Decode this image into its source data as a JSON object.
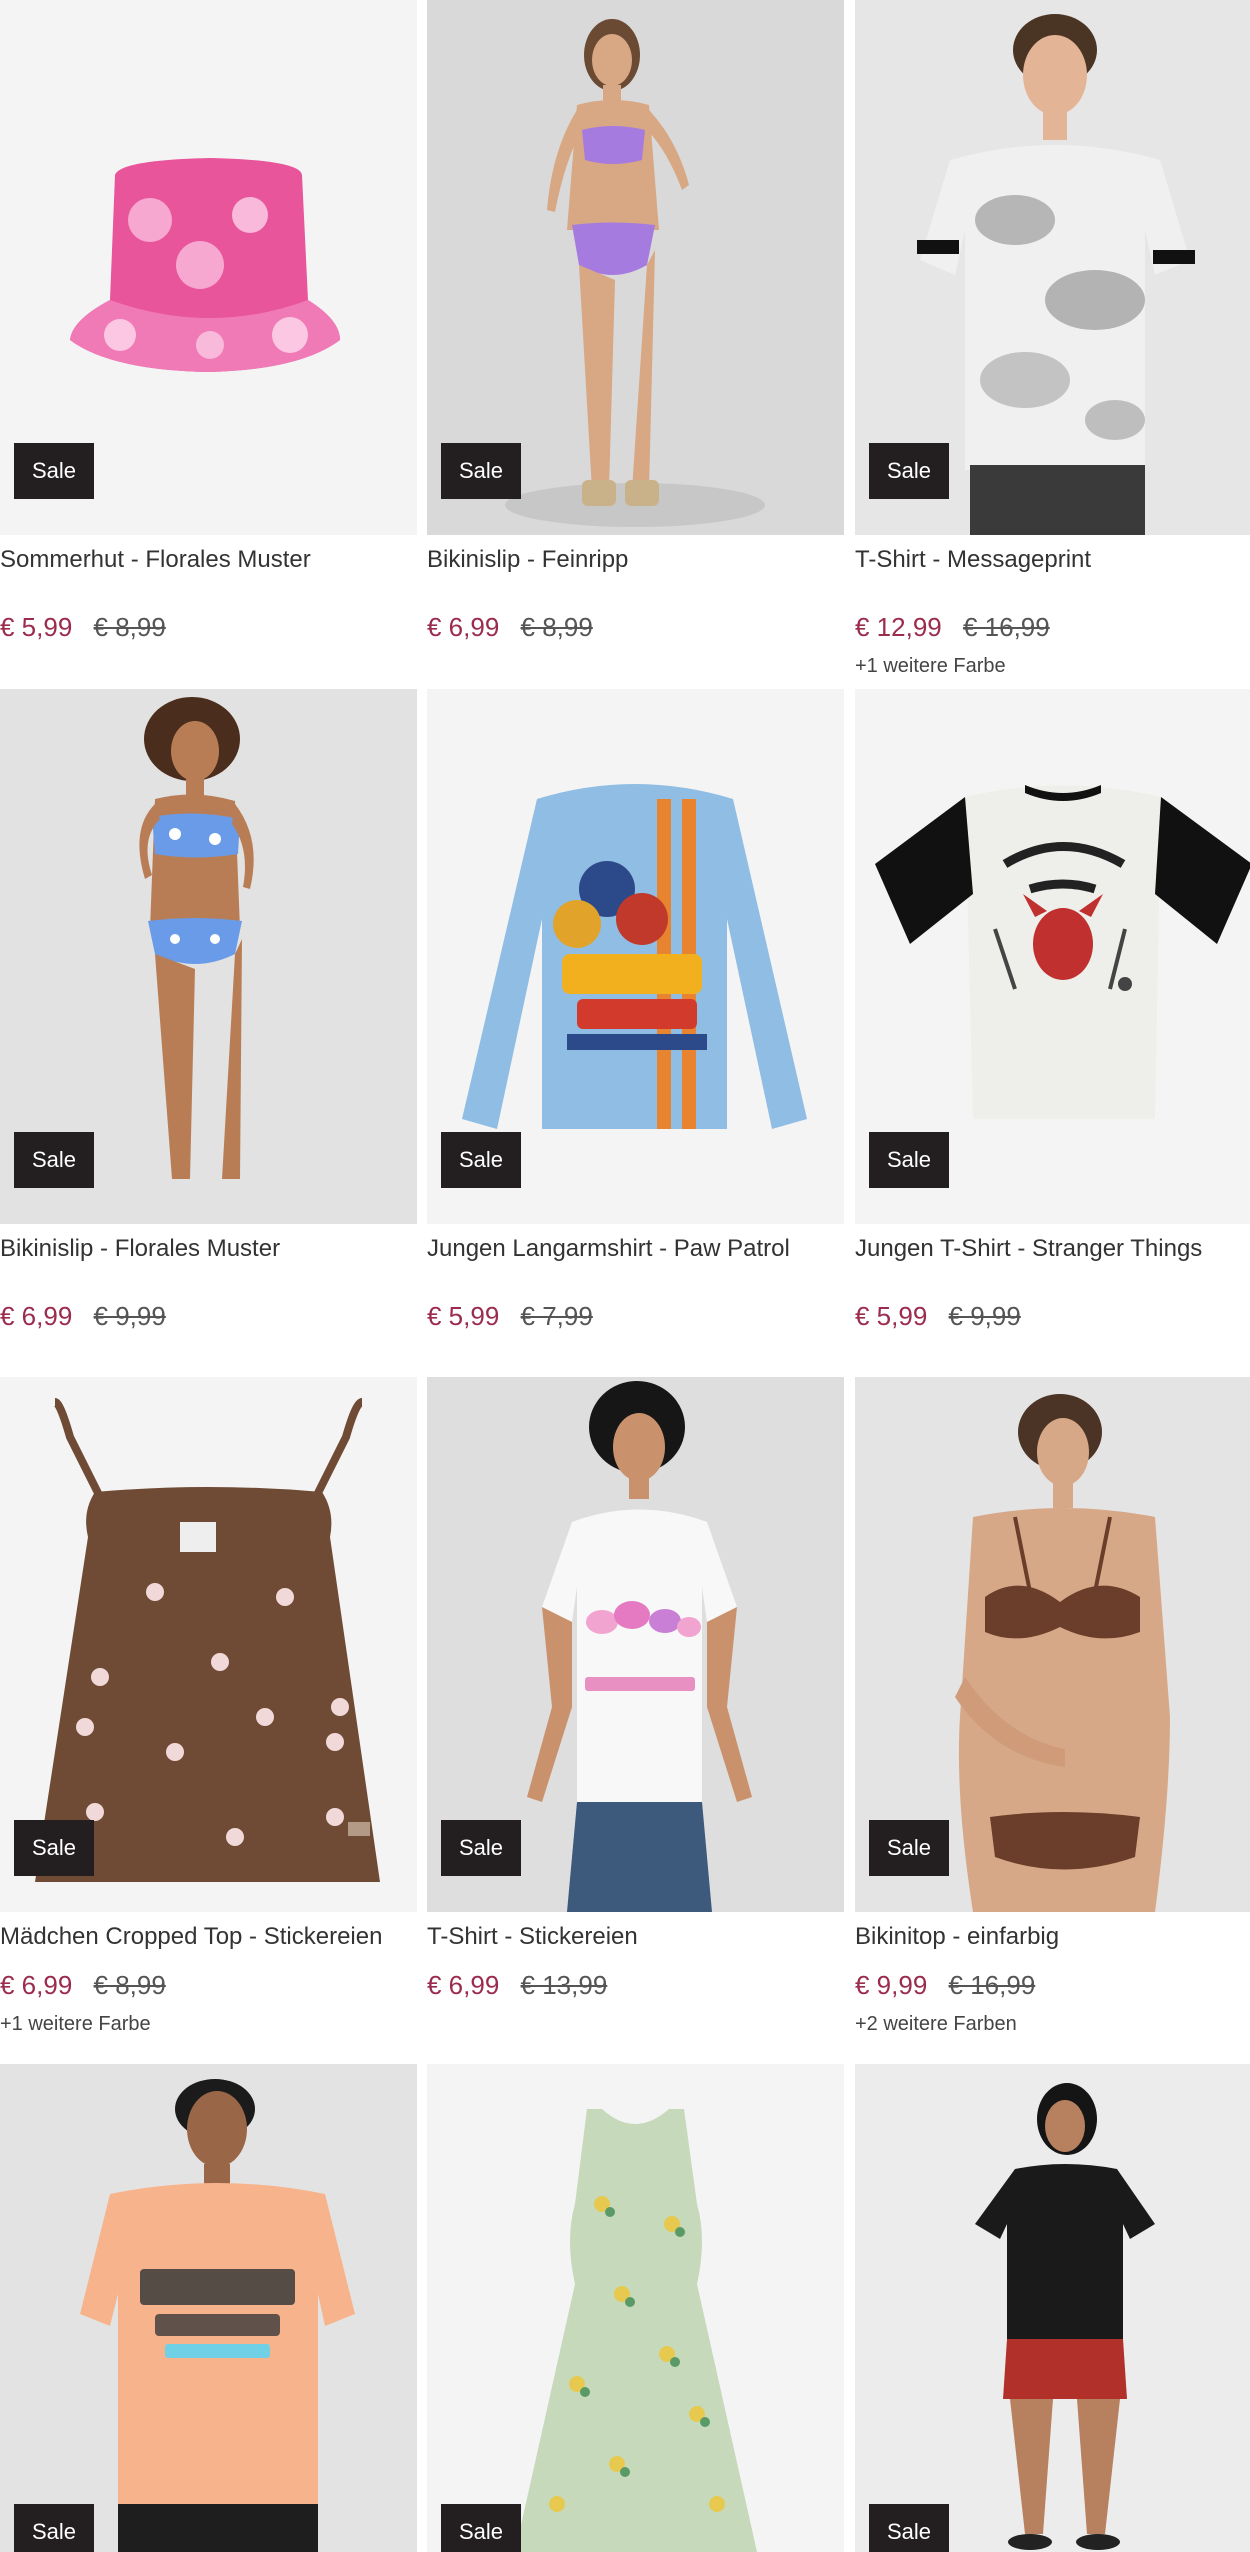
{
  "badge_label": "Sale",
  "colors": {
    "price_sale": "#9b2c4e",
    "badge_bg": "#231f20"
  },
  "products": [
    {
      "name": "Sommerhut - Florales Muster",
      "price": "€ 5,99",
      "old_price": "€ 8,99",
      "more_colors": "",
      "image": "pink-floral-bucket-hat"
    },
    {
      "name": "Bikinislip - Feinripp",
      "price": "€ 6,99",
      "old_price": "€ 8,99",
      "more_colors": "",
      "image": "model-lilac-bikini"
    },
    {
      "name": "T-Shirt - Messageprint",
      "price": "€ 12,99",
      "old_price": "€ 16,99",
      "more_colors": "+1 weitere Farbe",
      "image": "model-tie-dye-tshirt"
    },
    {
      "name": "Bikinislip - Florales Muster",
      "price": "€ 6,99",
      "old_price": "€ 9,99",
      "more_colors": "",
      "image": "model-blue-floral-bikini"
    },
    {
      "name": "Jungen Langarmshirt - Paw Patrol",
      "price": "€ 5,99",
      "old_price": "€ 7,99",
      "more_colors": "",
      "image": "paw-patrol-longsleeve"
    },
    {
      "name": "Jungen T-Shirt - Stranger Things",
      "price": "€ 5,99",
      "old_price": "€ 9,99",
      "more_colors": "",
      "image": "hellfire-club-tshirt"
    },
    {
      "name": "Mädchen Cropped Top - Stickereien",
      "price": "€ 6,99",
      "old_price": "€ 8,99",
      "more_colors": "+1 weitere Farbe",
      "image": "brown-floral-crop-top"
    },
    {
      "name": "T-Shirt - Stickereien",
      "price": "€ 6,99",
      "old_price": "€ 13,99",
      "more_colors": "",
      "image": "model-white-happiness-tshirt"
    },
    {
      "name": "Bikinitop - einfarbig",
      "price": "€ 9,99",
      "old_price": "€ 16,99",
      "more_colors": "+2 weitere Farben",
      "image": "model-brown-bikini"
    },
    {
      "name": "",
      "price": "",
      "old_price": "",
      "more_colors": "",
      "image": "model-los-angeles-tshirt"
    },
    {
      "name": "",
      "price": "",
      "old_price": "",
      "more_colors": "",
      "image": "green-floral-dress"
    },
    {
      "name": "",
      "price": "",
      "old_price": "",
      "more_colors": "",
      "image": "model-black-top-red-shorts"
    }
  ]
}
